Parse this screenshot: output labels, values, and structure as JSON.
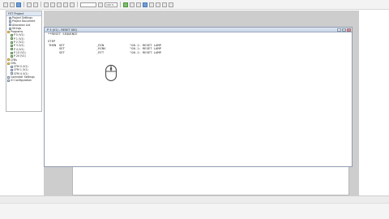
{
  "toolbar": {
    "zoom_value": "100 %",
    "combo_value": ""
  },
  "project_tree": {
    "title": "FST Project",
    "items": [
      {
        "label": "Project Settings",
        "icon": "settings-icon",
        "indent": 1
      },
      {
        "label": "Project Document",
        "icon": "document-icon",
        "indent": 1
      },
      {
        "label": "Allocation List",
        "icon": "list-icon",
        "indent": 1
      },
      {
        "label": "Strings",
        "icon": "strings-icon",
        "indent": 1
      },
      {
        "label": "Programs",
        "icon": "folder-icon",
        "indent": 0
      },
      {
        "label": "P 0 (V1)",
        "icon": "program-icon",
        "indent": 2
      },
      {
        "label": "P 1 (V1)",
        "icon": "program-icon",
        "indent": 2
      },
      {
        "label": "P 2 (V1)",
        "icon": "program-icon",
        "indent": 2
      },
      {
        "label": "P 3 (V1)",
        "icon": "program-icon",
        "indent": 2
      },
      {
        "label": "P 4 (V1)",
        "icon": "program-icon",
        "indent": 2
      },
      {
        "label": "P 10 (V1)",
        "icon": "program-icon",
        "indent": 2
      },
      {
        "label": "P 20 (V1)",
        "icon": "program-icon",
        "indent": 2
      },
      {
        "label": "CFBs",
        "icon": "folder-icon",
        "indent": 0
      },
      {
        "label": "CMs",
        "icon": "folder-icon",
        "indent": 0
      },
      {
        "label": "CFM 0 (V1)",
        "icon": "module-icon",
        "indent": 2
      },
      {
        "label": "CFM 1 (V1)",
        "icon": "module-icon",
        "indent": 2
      },
      {
        "label": "CFM 4 (V1)",
        "icon": "module-icon",
        "indent": 2
      },
      {
        "label": "Controller Settings",
        "icon": "controller-icon",
        "indent": 0
      },
      {
        "label": "IO Configuration",
        "icon": "io-icon",
        "indent": 0
      }
    ]
  },
  "editor": {
    "title": "P 3 (V1) - RESET SEQ",
    "code": {
      "comment_header": "**RESET SEQUENCE",
      "step_label": "STEP",
      "then_label": "THEN",
      "rows": [
        {
          "op": "SET",
          "arg": "_RIN",
          "comment": "\"O0.1: RESET LAMP"
        },
        {
          "op": "SET",
          "arg": "_RCNV",
          "comment": "\"O0.1: RESET LAMP"
        },
        {
          "op": "SET",
          "arg": "_RTT",
          "comment": "\"O0.1: RESET LAMP"
        }
      ]
    }
  },
  "colors": {
    "workspace_grey": "#cdcdcd",
    "title_gradient": "#c9d6e8",
    "mouse_outline": "#555555"
  }
}
